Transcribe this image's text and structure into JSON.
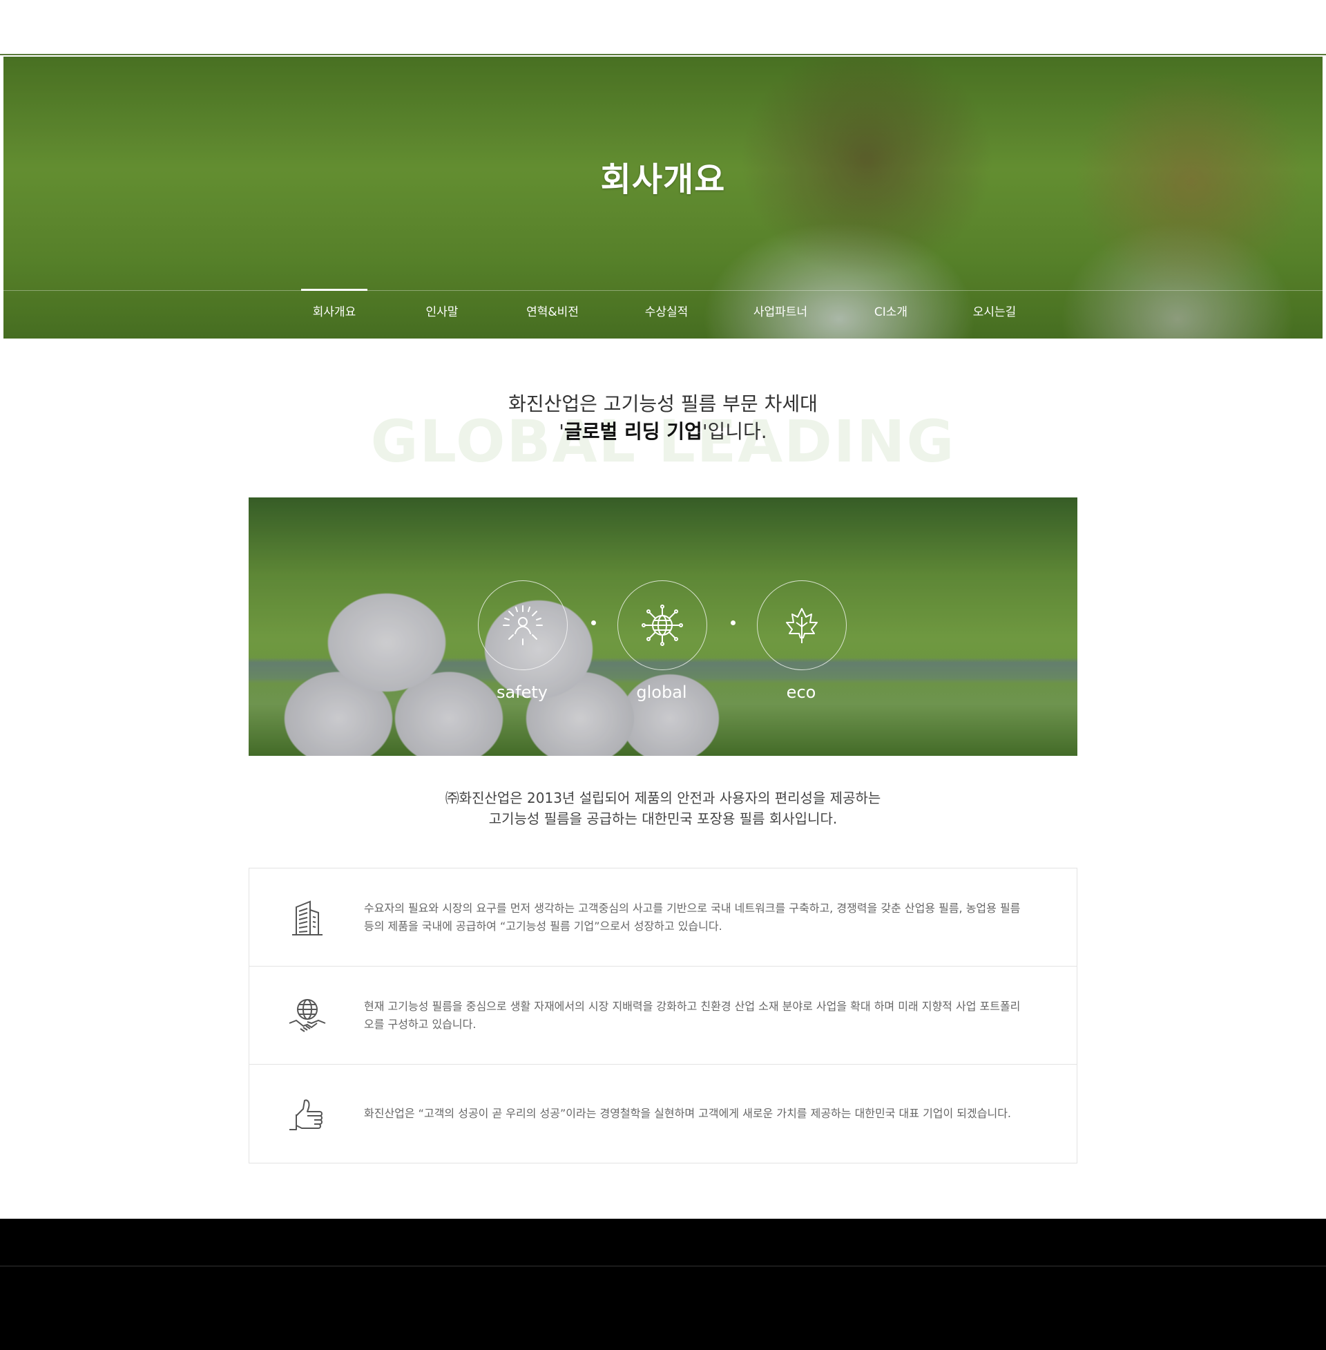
{
  "hero": {
    "title": "회사개요",
    "tabs": [
      {
        "label": "회사개요",
        "active": true
      },
      {
        "label": "인사말",
        "active": false
      },
      {
        "label": "연혁&비전",
        "active": false
      },
      {
        "label": "수상실적",
        "active": false
      },
      {
        "label": "사업파트너",
        "active": false
      },
      {
        "label": "CI소개",
        "active": false
      },
      {
        "label": "오시는길",
        "active": false
      }
    ]
  },
  "intro": {
    "background_text": "GLOBAL LEADING",
    "line1": "화진산업은 고기능성 필름 부문 차세대",
    "line2_quote_open": "'",
    "line2_bold": "글로벌 리딩 기업",
    "line2_rest": "'입니다."
  },
  "values": [
    {
      "label": "safety",
      "icon": "safety-person-icon"
    },
    {
      "label": "global",
      "icon": "globe-network-icon"
    },
    {
      "label": "eco",
      "icon": "leaf-icon"
    }
  ],
  "description": {
    "line1": "㈜화진산업은 2013년 설립되어 제품의 안전과 사용자의 편리성을 제공하는",
    "line2": "고기능성 필름을 공급하는 대한민국 포장용 필름 회사입니다."
  },
  "features": [
    {
      "icon": "building-icon",
      "text": "수요자의 필요와 시장의 요구를 먼저 생각하는 고객중심의 사고를 기반으로 국내 네트워크를 구축하고, 경쟁력을 갖춘 산업용 필름, 농업용 필름 등의 제품을 국내에 공급하여 “고기능성 필름 기업”으로서 성장하고 있습니다."
    },
    {
      "icon": "globe-handshake-icon",
      "text": "현재 고기능성 필름을 중심으로 생활 자재에서의 시장 지배력을 강화하고 친환경 산업 소재 분야로 사업을 확대 하며 미래 지향적 사업 포트폴리오를 구성하고 있습니다."
    },
    {
      "icon": "thumbs-up-icon",
      "text": "화진산업은 “고객의 성공이 곧 우리의 성공”이라는 경영철학을 실현하며 고객에게 새로운 가치를 제공하는 대한민국 대표 기업이 되겠습니다."
    }
  ],
  "colors": {
    "accent_green": "#5a7a3a",
    "text_dark": "#333333",
    "text_gray": "#666666",
    "footer_bg": "#000000"
  }
}
